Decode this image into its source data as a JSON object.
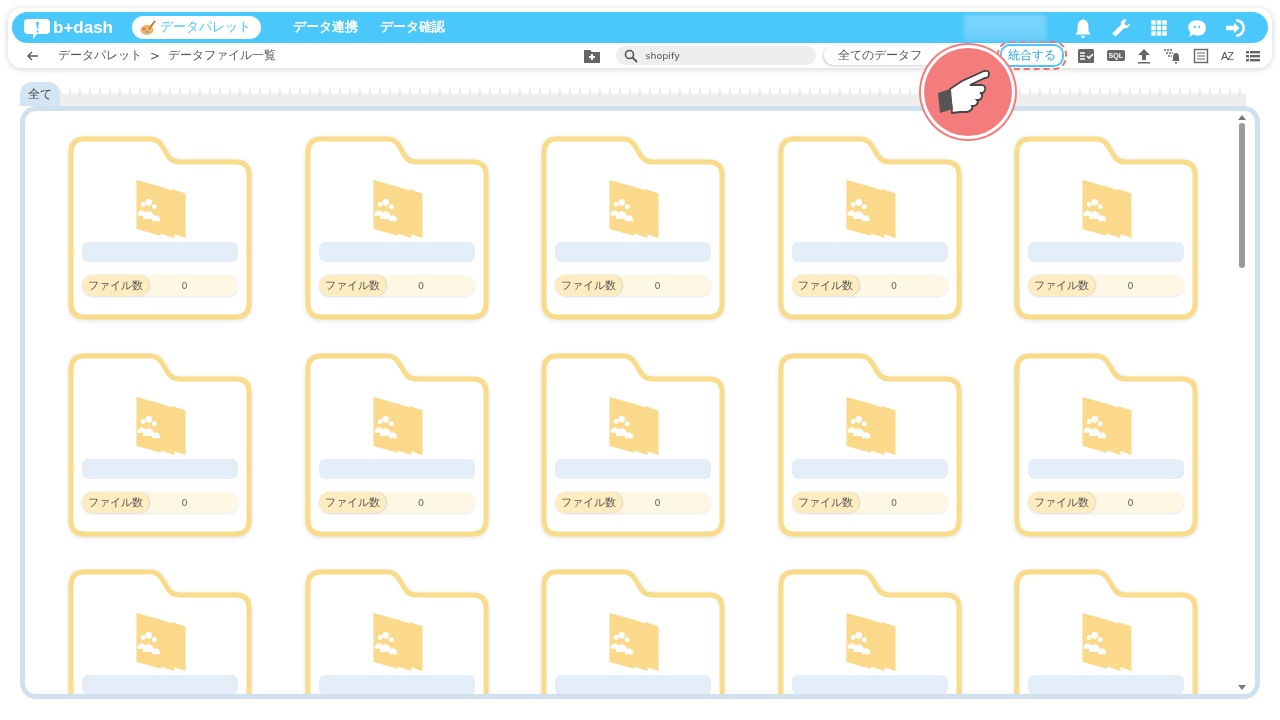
{
  "header": {
    "logo": "b+dash",
    "nav": [
      {
        "label": "データパレット",
        "selected": true
      },
      {
        "label": "データ連携",
        "selected": false
      },
      {
        "label": "データ確認",
        "selected": false
      }
    ]
  },
  "toolbar": {
    "breadcrumb": [
      {
        "label": "データパレット"
      },
      {
        "label": "データファイル一覧"
      }
    ],
    "separator": ">",
    "search": {
      "value": "shopify"
    },
    "filter": {
      "value": "全てのデータフ"
    },
    "merge_button": {
      "label": "統合する",
      "highlighted": true
    },
    "sql_label": "SQL",
    "sort_label": "AZ"
  },
  "tabs": [
    {
      "label": "全て",
      "selected": true
    }
  ],
  "cards": [
    {
      "kind": "full",
      "count_label": "ファイル数",
      "count": "0"
    },
    {
      "kind": "full",
      "count_label": "ファイル数",
      "count": "0"
    },
    {
      "kind": "full",
      "count_label": "ファイル数",
      "count": "0"
    },
    {
      "kind": "full",
      "count_label": "ファイル数",
      "count": "0"
    },
    {
      "kind": "full",
      "count_label": "ファイル数",
      "count": "0"
    },
    {
      "kind": "full",
      "count_label": "ファイル数",
      "count": "0"
    },
    {
      "kind": "full",
      "count_label": "ファイル数",
      "count": "0"
    },
    {
      "kind": "full",
      "count_label": "ファイル数",
      "count": "0"
    },
    {
      "kind": "full",
      "count_label": "ファイル数",
      "count": "0"
    },
    {
      "kind": "full",
      "count_label": "ファイル数",
      "count": "0"
    },
    {
      "kind": "cut"
    },
    {
      "kind": "cut"
    },
    {
      "kind": "cut"
    },
    {
      "kind": "cut"
    },
    {
      "kind": "cut"
    }
  ]
}
